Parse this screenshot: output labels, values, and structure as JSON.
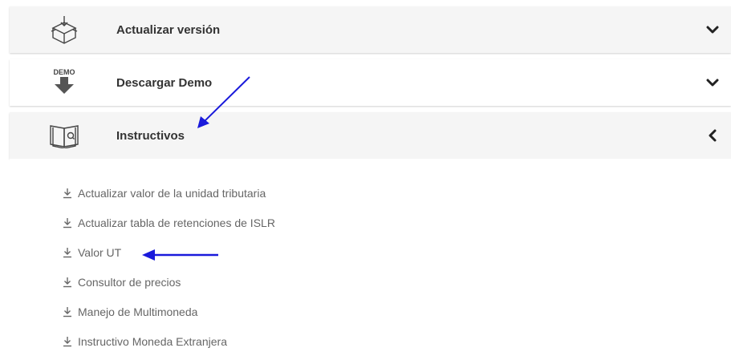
{
  "sections": [
    {
      "title": "Actualizar versión",
      "icon": "box-download-icon",
      "state": "collapsed"
    },
    {
      "title": "Descargar Demo",
      "icon": "demo-download-icon",
      "icon_text": "DEMO",
      "state": "collapsed"
    },
    {
      "title": "Instructivos",
      "icon": "book-icon",
      "state": "expanded"
    }
  ],
  "instructivos": [
    "Actualizar valor de la unidad tributaria",
    "Actualizar tabla de retenciones de ISLR",
    "Valor UT",
    "Consultor de precios",
    "Manejo de Multimoneda",
    "Instructivo Moneda Extranjera"
  ],
  "colors": {
    "annotation_arrow": "#1a1adb",
    "header_bg": "#f5f5f5",
    "link_text": "#666666"
  }
}
